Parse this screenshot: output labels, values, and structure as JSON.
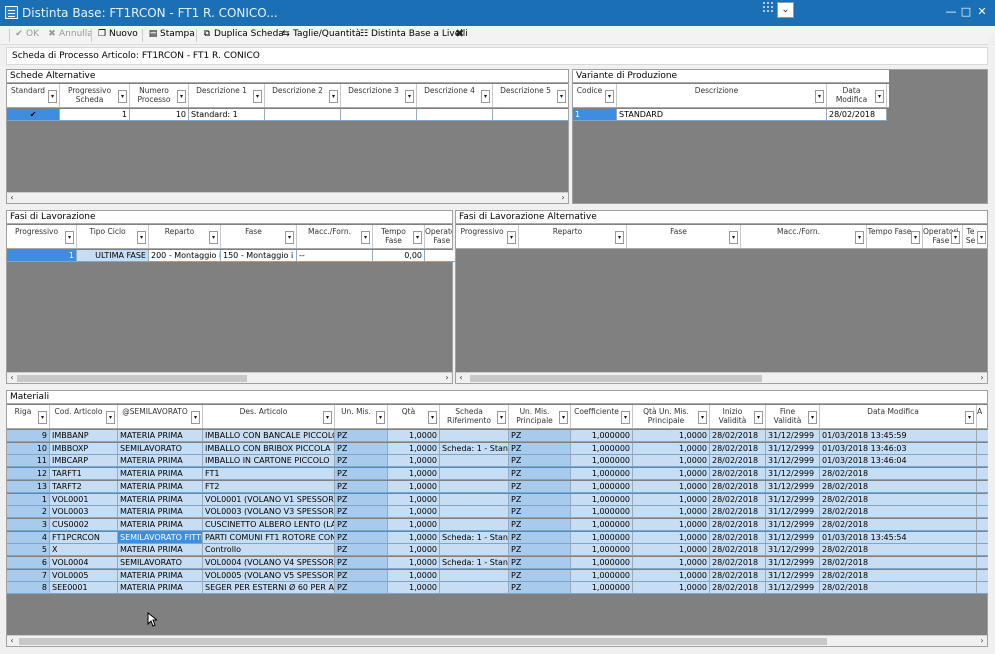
{
  "window": {
    "title": "Distinta Base: FT1RCON - FT1 R. CONICO...",
    "controls": [
      "—",
      "□",
      "✕"
    ]
  },
  "toolbar": {
    "ok": "OK",
    "annulla": "Annulla",
    "nuovo": "Nuovo",
    "stampa": "Stampa",
    "duplica": "Duplica Scheda",
    "taglie": "Taglie/Quantità",
    "distinta": "Distinta Base a Livelli",
    "close_icon": "✖"
  },
  "header": {
    "label": "Scheda di Processo Articolo: FT1RCON - FT1 R. CONICO"
  },
  "schede": {
    "title": "Schede Alternative",
    "columns": [
      {
        "label": "Standard"
      },
      {
        "label": "Progressivo\nScheda"
      },
      {
        "label": "Numero\nProcesso"
      },
      {
        "label": "Descrizione 1"
      },
      {
        "label": "Descrizione 2"
      },
      {
        "label": "Descrizione 3"
      },
      {
        "label": "Descrizione 4"
      },
      {
        "label": "Descrizione 5"
      }
    ],
    "rows": [
      [
        "✔",
        "1",
        "10",
        "Standard: 1",
        "",
        "",
        "",
        ""
      ]
    ]
  },
  "varianti": {
    "title": "Variante di Produzione",
    "columns": [
      {
        "label": "Codice"
      },
      {
        "label": "Descrizione"
      },
      {
        "label": "Data\nModifica"
      }
    ],
    "rows": [
      [
        "1",
        "STANDARD",
        "28/02/2018"
      ]
    ]
  },
  "fasi": {
    "title": "Fasi di Lavorazione",
    "columns": [
      {
        "label": "Progressivo"
      },
      {
        "label": "Tipo Ciclo"
      },
      {
        "label": "Reparto"
      },
      {
        "label": "Fase"
      },
      {
        "label": "Macc./Forn."
      },
      {
        "label": "Tempo\nFase"
      },
      {
        "label": "Operator\nFase"
      }
    ],
    "rows": [
      [
        "1",
        "ULTIMA FASE",
        "200 - Montaggio int",
        "150 - Montaggio i",
        "--",
        "0,00",
        ""
      ]
    ]
  },
  "fasiAlt": {
    "title": "Fasi di Lavorazione Alternative",
    "columns": [
      {
        "label": "Progressivo"
      },
      {
        "label": "Reparto"
      },
      {
        "label": "Fase"
      },
      {
        "label": "Macc./Forn."
      },
      {
        "label": "Tempo Fase"
      },
      {
        "label": "Operatori\nFase"
      },
      {
        "label": "Te\nSe"
      }
    ]
  },
  "materiali": {
    "title": "Materiali",
    "columns": [
      {
        "label": "Riga"
      },
      {
        "label": "Cod. Articolo"
      },
      {
        "label": "@SEMILAVORATO"
      },
      {
        "label": "Des. Articolo"
      },
      {
        "label": "Un. Mis."
      },
      {
        "label": "Qtà"
      },
      {
        "label": "Scheda\nRiferimento"
      },
      {
        "label": "Un. Mis.\nPrincipale"
      },
      {
        "label": "Coefficiente"
      },
      {
        "label": "Qtà Un. Mis.\nPrincipale"
      },
      {
        "label": "Inizio\nValidità"
      },
      {
        "label": "Fine\nValidità"
      },
      {
        "label": "Data Modifica"
      },
      {
        "label": "A"
      }
    ],
    "rows": [
      [
        "9",
        "IMBBANP",
        "MATERIA PRIMA",
        "IMBALLO CON BANCALE PICCOLO",
        "PZ",
        "1,0000",
        "",
        "PZ",
        "1,000000",
        "1,0000",
        "28/02/2018",
        "31/12/2999",
        "01/03/2018 13:45:59",
        ""
      ],
      [
        "10",
        "IMBBOXP",
        "SEMILAVORATO",
        "IMBALLO CON BRIBOX PICCOLA",
        "PZ",
        "1,0000",
        "Scheda: 1 - Standar",
        "PZ",
        "1,000000",
        "1,0000",
        "28/02/2018",
        "31/12/2999",
        "01/03/2018 13:46:03",
        ""
      ],
      [
        "11",
        "IMBCARP",
        "MATERIA PRIMA",
        "IMBALLO IN CARTONE PICCOLO",
        "PZ",
        "1,0000",
        "",
        "PZ",
        "1,000000",
        "1,0000",
        "28/02/2018",
        "31/12/2999",
        "01/03/2018 13:46:04",
        ""
      ],
      [
        "12",
        "TARFT1",
        "MATERIA PRIMA",
        "FT1",
        "PZ",
        "1,0000",
        "",
        "PZ",
        "1,000000",
        "1,0000",
        "28/02/2018",
        "31/12/2999",
        "28/02/2018",
        ""
      ],
      [
        "13",
        "TARFT2",
        "MATERIA PRIMA",
        "FT2",
        "PZ",
        "1,0000",
        "",
        "PZ",
        "1,000000",
        "1,0000",
        "28/02/2018",
        "31/12/2999",
        "28/02/2018",
        ""
      ],
      [
        "1",
        "VOL0001",
        "MATERIA PRIMA",
        "VOL0001 (VOLANO V1 SPESSORE 15",
        "PZ",
        "1,0000",
        "",
        "PZ",
        "1,000000",
        "1,0000",
        "28/02/2018",
        "31/12/2999",
        "28/02/2018",
        ""
      ],
      [
        "2",
        "VOL0003",
        "MATERIA PRIMA",
        "VOL0003 (VOLANO V3 SPESSORE 3",
        "PZ",
        "1,0000",
        "",
        "PZ",
        "1,000000",
        "1,0000",
        "28/02/2018",
        "31/12/2999",
        "28/02/2018",
        ""
      ],
      [
        "3",
        "CUS0002",
        "MATERIA PRIMA",
        "CUSCINETTO ALBERO LENTO (LATO",
        "PZ",
        "1,0000",
        "",
        "PZ",
        "1,000000",
        "1,0000",
        "28/02/2018",
        "31/12/2999",
        "28/02/2018",
        ""
      ],
      [
        "4",
        "FT1PCRCON",
        "SEMILAVORATO FITTIZ",
        "PARTI COMUNI FT1 ROTORE CONIC",
        "PZ",
        "1,0000",
        "Scheda: 1 - Standar",
        "PZ",
        "1,000000",
        "1,0000",
        "28/02/2018",
        "31/12/2999",
        "01/03/2018 13:45:54",
        ""
      ],
      [
        "5",
        "X",
        "MATERIA PRIMA",
        "Controllo",
        "PZ",
        "1,0000",
        "",
        "PZ",
        "1,000000",
        "1,0000",
        "28/02/2018",
        "31/12/2999",
        "28/02/2018",
        ""
      ],
      [
        "6",
        "VOL0004",
        "SEMILAVORATO",
        "VOL0004 (VOLANO V4 SPESSORE 5",
        "PZ",
        "1,0000",
        "Scheda: 1 - Standar",
        "PZ",
        "1,000000",
        "1,0000",
        "28/02/2018",
        "31/12/2999",
        "28/02/2018",
        ""
      ],
      [
        "7",
        "VOL0005",
        "MATERIA PRIMA",
        "VOL0005 (VOLANO V5 SPESSORE 6",
        "PZ",
        "1,0000",
        "",
        "PZ",
        "1,000000",
        "1,0000",
        "28/02/2018",
        "31/12/2999",
        "28/02/2018",
        ""
      ],
      [
        "8",
        "SEE0001",
        "MATERIA PRIMA",
        "SEGER PER ESTERNI Ø 60 PER ALBE",
        "PZ",
        "1,0000",
        "",
        "PZ",
        "1,000000",
        "1,0000",
        "28/02/2018",
        "31/12/2999",
        "28/02/2018",
        ""
      ]
    ]
  },
  "scroll": {
    "left": "‹",
    "right": "›"
  },
  "colors": {
    "titlebar": "#1a6fb5",
    "selection": "#3d8ee0",
    "rowBlue": "#a8cbed",
    "rowLight": "#c6ddf3",
    "grid": "#808080"
  }
}
